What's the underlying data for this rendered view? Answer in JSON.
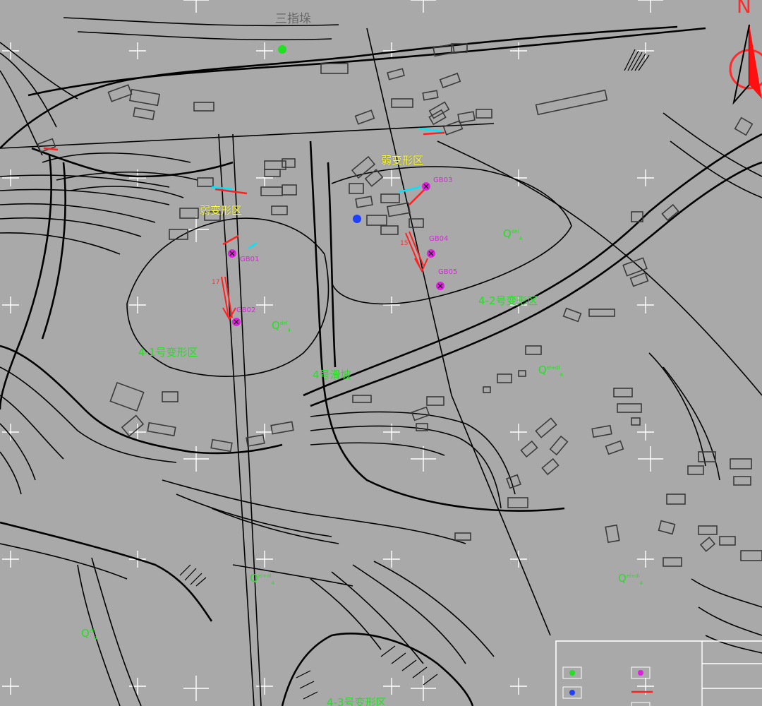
{
  "map": {
    "place_name": "三指垛",
    "north_label": "N",
    "zones": {
      "weak_zone_1": "弱变形区",
      "weak_zone_2": "弱变形区",
      "zone_4_1": "4-1号变形区",
      "zone_4_2": "4-2号变形区",
      "zone_4_slide": "4号滑坡",
      "zone_bottom": "4-3号变形区"
    },
    "gb_points": [
      "GB01",
      "GB02",
      "GB03",
      "GB04",
      "GB05"
    ],
    "angles": [
      "17",
      "15"
    ],
    "q_symbol": "Q",
    "q_superscripts": {
      "q1": "del",
      "q2": "del",
      "q3": "el+dl",
      "q4": "el+dl",
      "q5": "el+dl",
      "q6": "dl"
    },
    "q_subscript": "4",
    "colors": {
      "background": "#a9a9a9",
      "zone_green": "#22e022",
      "zone_yellow": "#ffff3a",
      "monitor_magenta": "#e020e0",
      "arrow_red": "#ff2020",
      "crack_cyan": "#00e5ff",
      "north_red": "#ff2a2a"
    },
    "icons": [
      "monitor-point-icon",
      "north-arrow-icon",
      "displacement-arrow-icon",
      "crack-icon",
      "gps-point-icon"
    ]
  }
}
